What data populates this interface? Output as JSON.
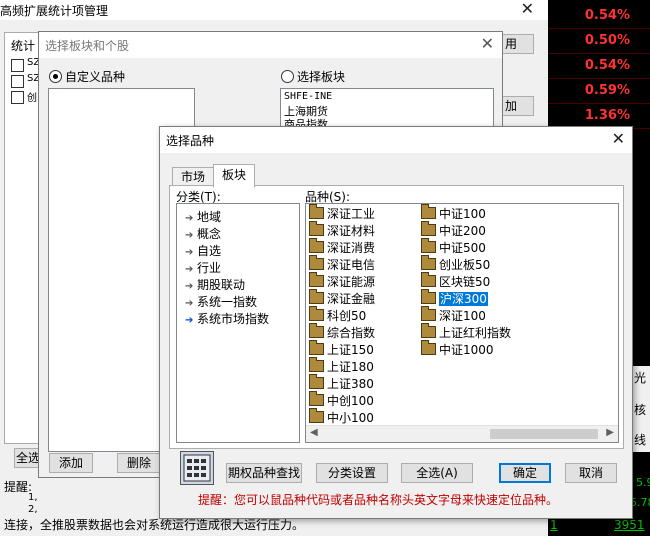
{
  "bg_window": {
    "title": "高频扩展统计项管理",
    "stat_label": "统计",
    "checks": [
      "SZ",
      "SZ",
      "创"
    ],
    "btn_select_all": "全选",
    "hint_label": "提醒:",
    "hint_lines": [
      "1,",
      "2,",
      "连接，全推股票数据也会对系统运行造成很大运行压力。"
    ],
    "btn_right1": "用",
    "btn_right2": "加"
  },
  "quote_strip": {
    "values": [
      "0.54%",
      "0.50%",
      "0.54%",
      "0.59%",
      "1.36%"
    ],
    "bottom_texts": [
      "光",
      "核",
      "线"
    ],
    "bottom_row": {
      "left": "1",
      "right": "3951",
      "mid_a": "5.9",
      "mid_b": "5.78"
    }
  },
  "mid_dialog": {
    "title": "选择板块和个股",
    "radio_custom": "自定义品种",
    "radio_sector": "选择板块",
    "sector_items": [
      "SHFE-INE",
      "上海期货",
      "商品指数"
    ],
    "btn_add": "添加",
    "btn_delete": "删除"
  },
  "main_dialog": {
    "title": "选择品种",
    "tabs": [
      "市场",
      "板块"
    ],
    "category_label": "分类(T):",
    "variety_label": "品种(S):",
    "categories": [
      "地域",
      "概念",
      "自选",
      "行业",
      "期股联动",
      "系统一指数",
      "系统市场指数"
    ],
    "varieties_col1": [
      "深证工业",
      "深证材料",
      "深证消费",
      "深证电信",
      "深证能源",
      "深证金融",
      "科创50",
      "综合指数",
      "上证150",
      "上证180",
      "上证380",
      "中创100",
      "中小100"
    ],
    "varieties_col2": [
      "中证100",
      "中证200",
      "中证500",
      "创业板50",
      "区块链50",
      "沪深300",
      "深证100",
      "上证红利指数",
      "中证1000"
    ],
    "selected": "沪深300",
    "btn_option_search": "期权品种查找",
    "btn_category_settings": "分类设置",
    "btn_select_all": "全选(A)",
    "btn_ok": "确定",
    "btn_cancel": "取消",
    "hint": "提醒：您可以鼠品种代码或者品种名称头英文字母来快速定位品种。",
    "hint_color": "#c00000"
  }
}
